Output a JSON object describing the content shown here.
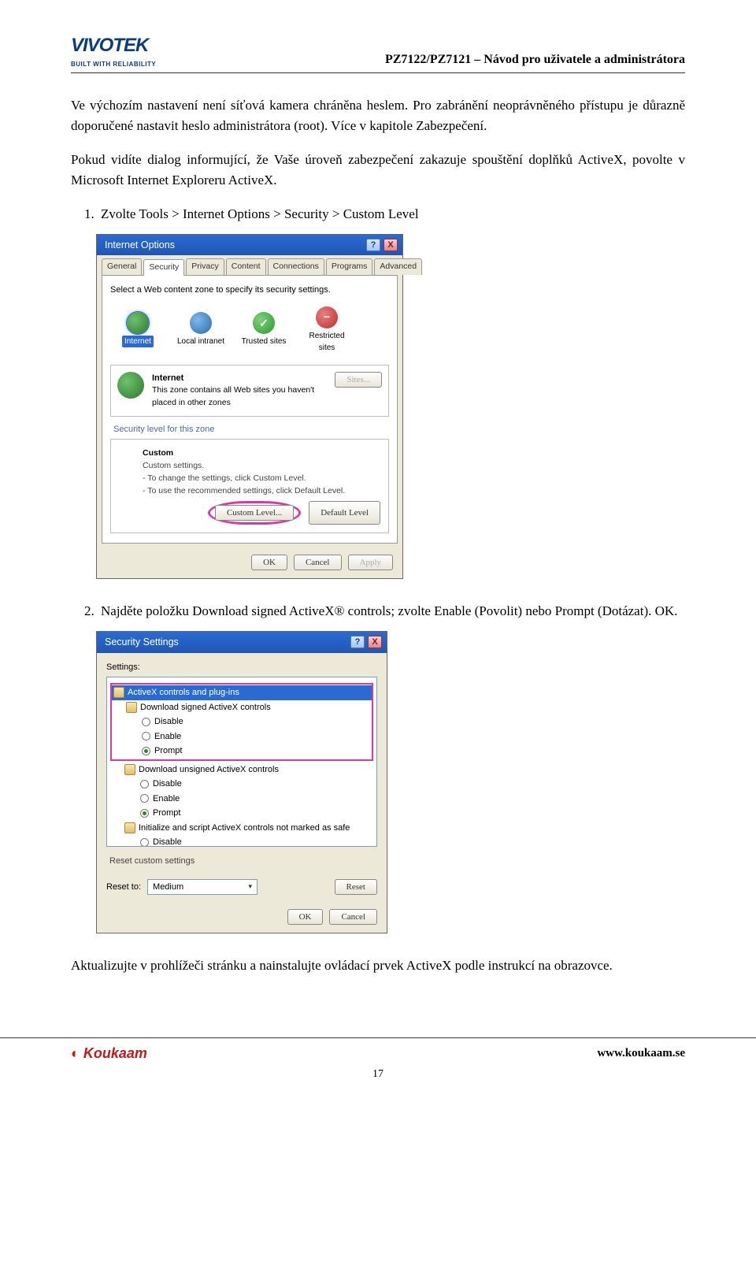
{
  "header": {
    "logo_main": "VIVOTEK",
    "logo_sub": "BUILT WITH RELIABILITY",
    "doc_title": "PZ7122/PZ7121 – Návod pro uživatele a administrátora"
  },
  "para1": "Ve výchozím nastavení není síťová kamera chráněna heslem. Pro zabránění neoprávněného přístupu je důrazně doporučené nastavit heslo administrátora (root). Více v kapitole Zabezpečení.",
  "para2": "Pokud vidíte dialog informující, že Vaše úroveň zabezpečení zakazuje spouštění doplňků ActiveX, povolte v Microsoft Internet Exploreru ActiveX.",
  "step1": "Zvolte Tools > Internet Options > Security > Custom Level",
  "dlg1": {
    "title": "Internet Options",
    "tabs": [
      "General",
      "Security",
      "Privacy",
      "Content",
      "Connections",
      "Programs",
      "Advanced"
    ],
    "zone_prompt": "Select a Web content zone to specify its security settings.",
    "zones": [
      "Internet",
      "Local intranet",
      "Trusted sites",
      "Restricted sites"
    ],
    "zone_info_title": "Internet",
    "zone_info_text": "This zone contains all Web sites you haven't placed in other zones",
    "sites_btn": "Sites...",
    "sec_level_label": "Security level for this zone",
    "custom_title": "Custom",
    "custom_sub": "Custom settings.",
    "custom_line1": "- To change the settings, click Custom Level.",
    "custom_line2": "- To use the recommended settings, click Default Level.",
    "custom_level_btn": "Custom Level...",
    "default_level_btn": "Default Level",
    "ok": "OK",
    "cancel": "Cancel",
    "apply": "Apply"
  },
  "step2": "Najděte položku  Download signed ActiveX® controls; zvolte Enable (Povolit) nebo Prompt (Dotázat). OK.",
  "dlg2": {
    "title": "Security Settings",
    "settings_label": "Settings:",
    "root": "ActiveX controls and plug-ins",
    "g1": "Download signed ActiveX controls",
    "g2": "Download unsigned ActiveX controls",
    "g3": "Initialize and script ActiveX controls not marked as safe",
    "opt_disable": "Disable",
    "opt_enable": "Enable",
    "opt_prompt": "Prompt",
    "reset_label": "Reset custom settings",
    "reset_to": "Reset to:",
    "reset_value": "Medium",
    "reset_btn": "Reset",
    "ok": "OK",
    "cancel": "Cancel"
  },
  "para3": "Aktualizujte v prohlížeči stránku a nainstalujte ovládací prvek ActiveX podle instrukcí na obrazovce.",
  "footer": {
    "logo": "Koukaam",
    "url": "www.koukaam.se",
    "page": "17"
  }
}
